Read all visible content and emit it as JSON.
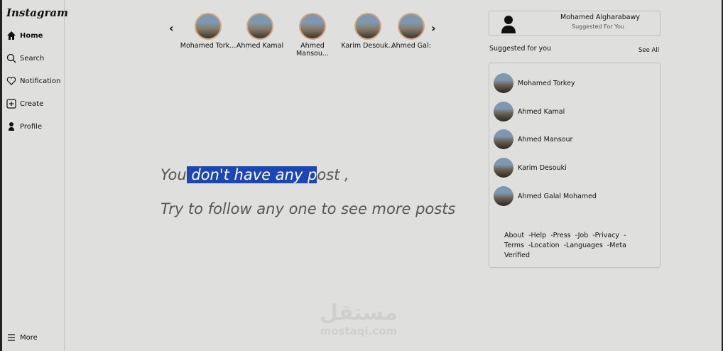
{
  "sidebar": {
    "logo": "Instagram",
    "items": [
      {
        "label": "Home",
        "icon": "home-icon"
      },
      {
        "label": "Search",
        "icon": "search-icon"
      },
      {
        "label": "Notification",
        "icon": "heart-icon"
      },
      {
        "label": "Create",
        "icon": "plus-square-icon"
      },
      {
        "label": "Profile",
        "icon": "user-icon"
      }
    ],
    "more": "More"
  },
  "stories": [
    "Mohamed Tork...",
    "Ahmed Kamal",
    "Ahmed Mansou...",
    "Karim Desouk...",
    "Ahmed Gal:"
  ],
  "feed": {
    "line1_a": "You",
    "line1_sel": " don't have any p",
    "line1_b": "ost ,",
    "line2": "Try to follow any one to see more posts"
  },
  "profile": {
    "name": "Mohamed Algharabawy",
    "subtitle": "Suggested For You"
  },
  "suggested": {
    "title": "Suggested for you",
    "see_all": "See All",
    "users": [
      "Mohamed Torkey",
      "Ahmed Kamal",
      "Ahmed Mansour",
      "Karim Desouki",
      "Ahmed Galal Mohamed"
    ]
  },
  "footer_links": [
    "About",
    "-Help",
    "-Press",
    "-Job",
    "-Privacy",
    "-",
    "Terms",
    "-Location",
    "-Languages",
    "-Meta",
    "Verified"
  ],
  "watermark": {
    "arabic": "مستقل",
    "latin": "mostaqi.com"
  }
}
